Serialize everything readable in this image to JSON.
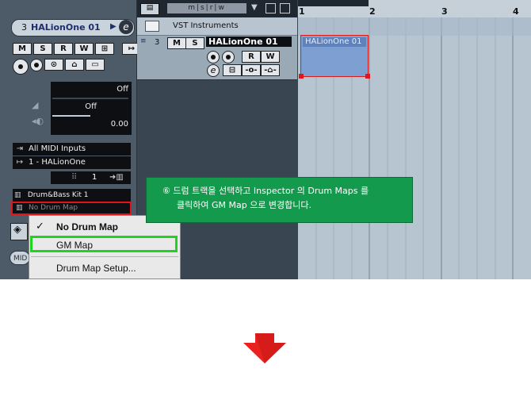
{
  "inspector": {
    "track_number": "3",
    "track_name": "HALionOne 01",
    "edit_button": "e",
    "buttons_row1": [
      "M",
      "S",
      "R",
      "W",
      "⊞"
    ],
    "volume_value": "Off",
    "pan_value": "Off",
    "delay_value": "0.00",
    "input": "All MIDI Inputs",
    "output": "1 - HALionOne",
    "channel": "1",
    "program": "Drum&Bass Kit 1",
    "drum_map_selected": "No Drum Map",
    "midi_tab": "MID"
  },
  "drum_menu": {
    "items": [
      "No Drum Map",
      "GM Map",
      "Drum Map Setup..."
    ],
    "checked": "No Drum Map",
    "check": "✓"
  },
  "track_list": {
    "folder_label": "VST Instruments",
    "track_number": "3",
    "track_name": "HALionOne 01",
    "buttons": [
      "M",
      "S",
      "R",
      "W"
    ],
    "edit_button": "e"
  },
  "ruler": {
    "bars": [
      "1",
      "2",
      "3",
      "4"
    ]
  },
  "event": {
    "name": "HALionOne 01"
  },
  "annotation": {
    "line1": "⑥ 드럼 트랙을 선택하고 Inspector 의 Drum Maps 를",
    "line2": "클릭하여 GM Map 으로 변경합니다."
  },
  "colors": {
    "callout_green": "#139a4d",
    "highlight_red": "#e0141a",
    "highlight_green": "#21d321",
    "down_arrow": "#e8231f"
  }
}
